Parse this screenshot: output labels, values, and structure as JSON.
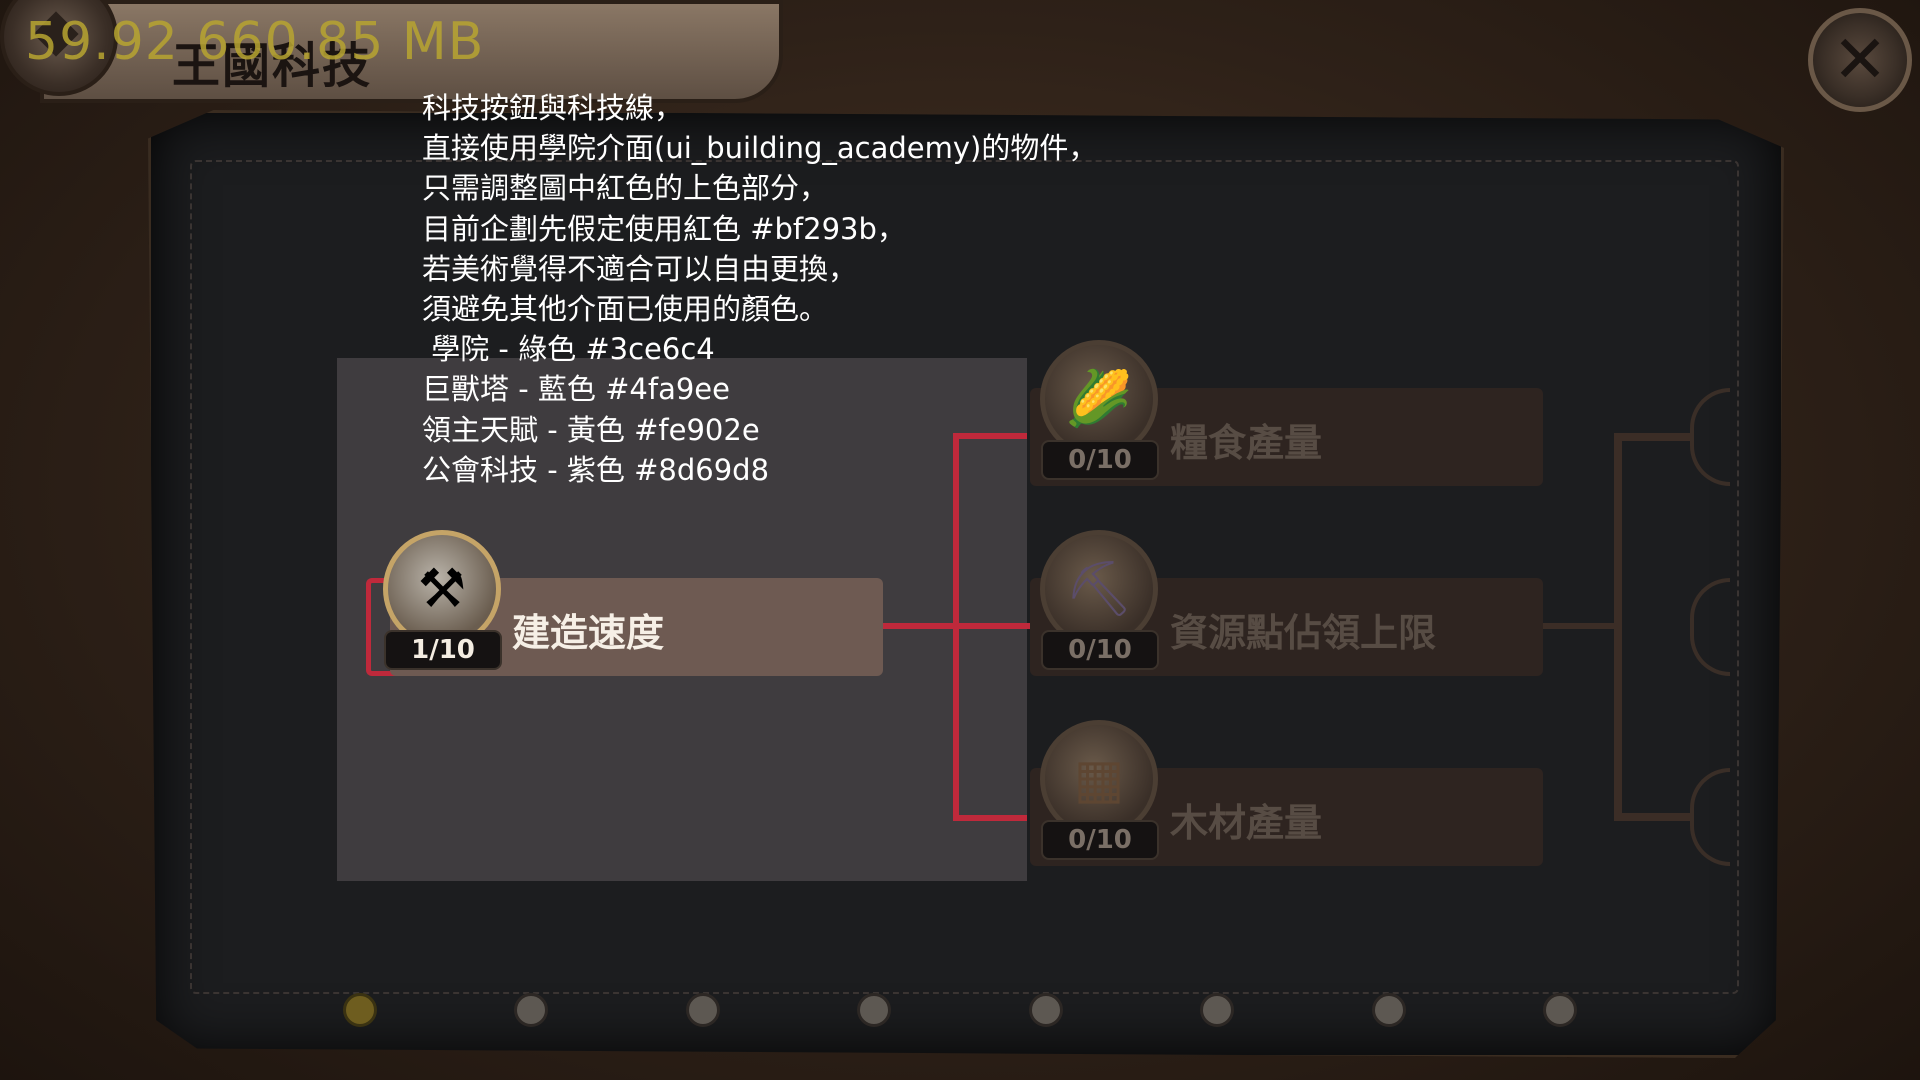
{
  "debug_overlay": "59.92   660.85 MB",
  "header": {
    "title": "王國科技"
  },
  "note_lines": [
    "科技按鈕與科技線，",
    "直接使用學院介面(ui_building_academy)的物件，",
    "只需調整圖中紅色的上色部分，",
    "目前企劃先假定使用紅色 #bf293b，",
    "若美術覺得不適合可以自由更換，",
    "須避免其他介面已使用的顏色。",
    " 學院 - 綠色 #3ce6c4",
    "巨獸塔 - 藍色 #4fa9ee",
    "領主天賦 - 黃色 #fe902e",
    "公會科技 - 紫色 #8d69d8"
  ],
  "colors": {
    "accent_red": "#bf293b",
    "academy_green": "#3ce6c4",
    "beast_tower_blue": "#4fa9ee",
    "lord_talent_yellow": "#fe902e",
    "guild_tech_purple": "#8d69d8"
  },
  "tech_nodes": [
    {
      "label": "建造速度",
      "level": "1/10",
      "icon": "drill-hammer-icon",
      "active": true
    },
    {
      "label": "糧食產量",
      "level": "0/10",
      "icon": "corn-sack-icon",
      "active": false
    },
    {
      "label": "資源點佔領上限",
      "level": "0/10",
      "icon": "ore-cart-icon",
      "active": false
    },
    {
      "label": "木材產量",
      "level": "0/10",
      "icon": "lumber-planks-icon",
      "active": false
    }
  ],
  "pagination": {
    "total": 8,
    "current": 1
  },
  "close_icon": "close-icon"
}
